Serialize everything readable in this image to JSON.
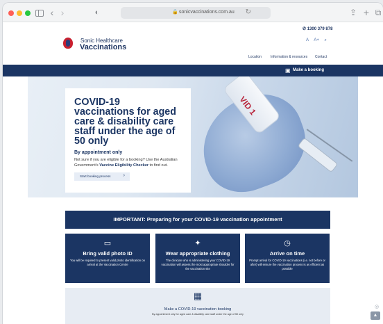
{
  "browser": {
    "url": "sonicvaccinations.com.au"
  },
  "header": {
    "phone": "1300 379 878",
    "logo_top": "Sonic Healthcare",
    "logo_bottom": "Vaccinations",
    "font_small": "A",
    "font_large": "A+",
    "nav": {
      "location": "Location",
      "info": "Information & resources",
      "contact": "Contact"
    },
    "booking_link": "Make a booking"
  },
  "hero": {
    "vial_text": "VID 1",
    "title": "COVID-19 vaccinations for aged care & disability care staff under the age of 50 only",
    "subtitle": "By appointment only",
    "text_prefix": "Not sure if you are eligible for a booking? Use the Australian Government's",
    "text_link": "Vaccine Eligibility Checker",
    "text_suffix": "to find out.",
    "button": "Start booking process"
  },
  "important": "IMPORTANT: Preparing for your COVID-19 vaccination appointment",
  "features": [
    {
      "icon": "id-card-icon",
      "title": "Bring valid photo ID",
      "text": "You will be required to present valid photo identification on arrival at the Vaccination Centre"
    },
    {
      "icon": "shirt-icon",
      "title": "Wear appropriate clothing",
      "text": "The clinician who is administering your COVID-19 vaccination will assess the most appropriate shoulder for the vaccination site"
    },
    {
      "icon": "clock-icon",
      "title": "Arrive on time",
      "text": "Prompt arrival for COVID-19 vaccinations (i.e. not before or after) will ensure the vaccination process is as efficient as possible"
    }
  ],
  "booking_box": {
    "title": "Make a COVID-19 vaccination booking",
    "subtitle": "By appointment only for aged care & disability care staff under the age of 50 only"
  }
}
